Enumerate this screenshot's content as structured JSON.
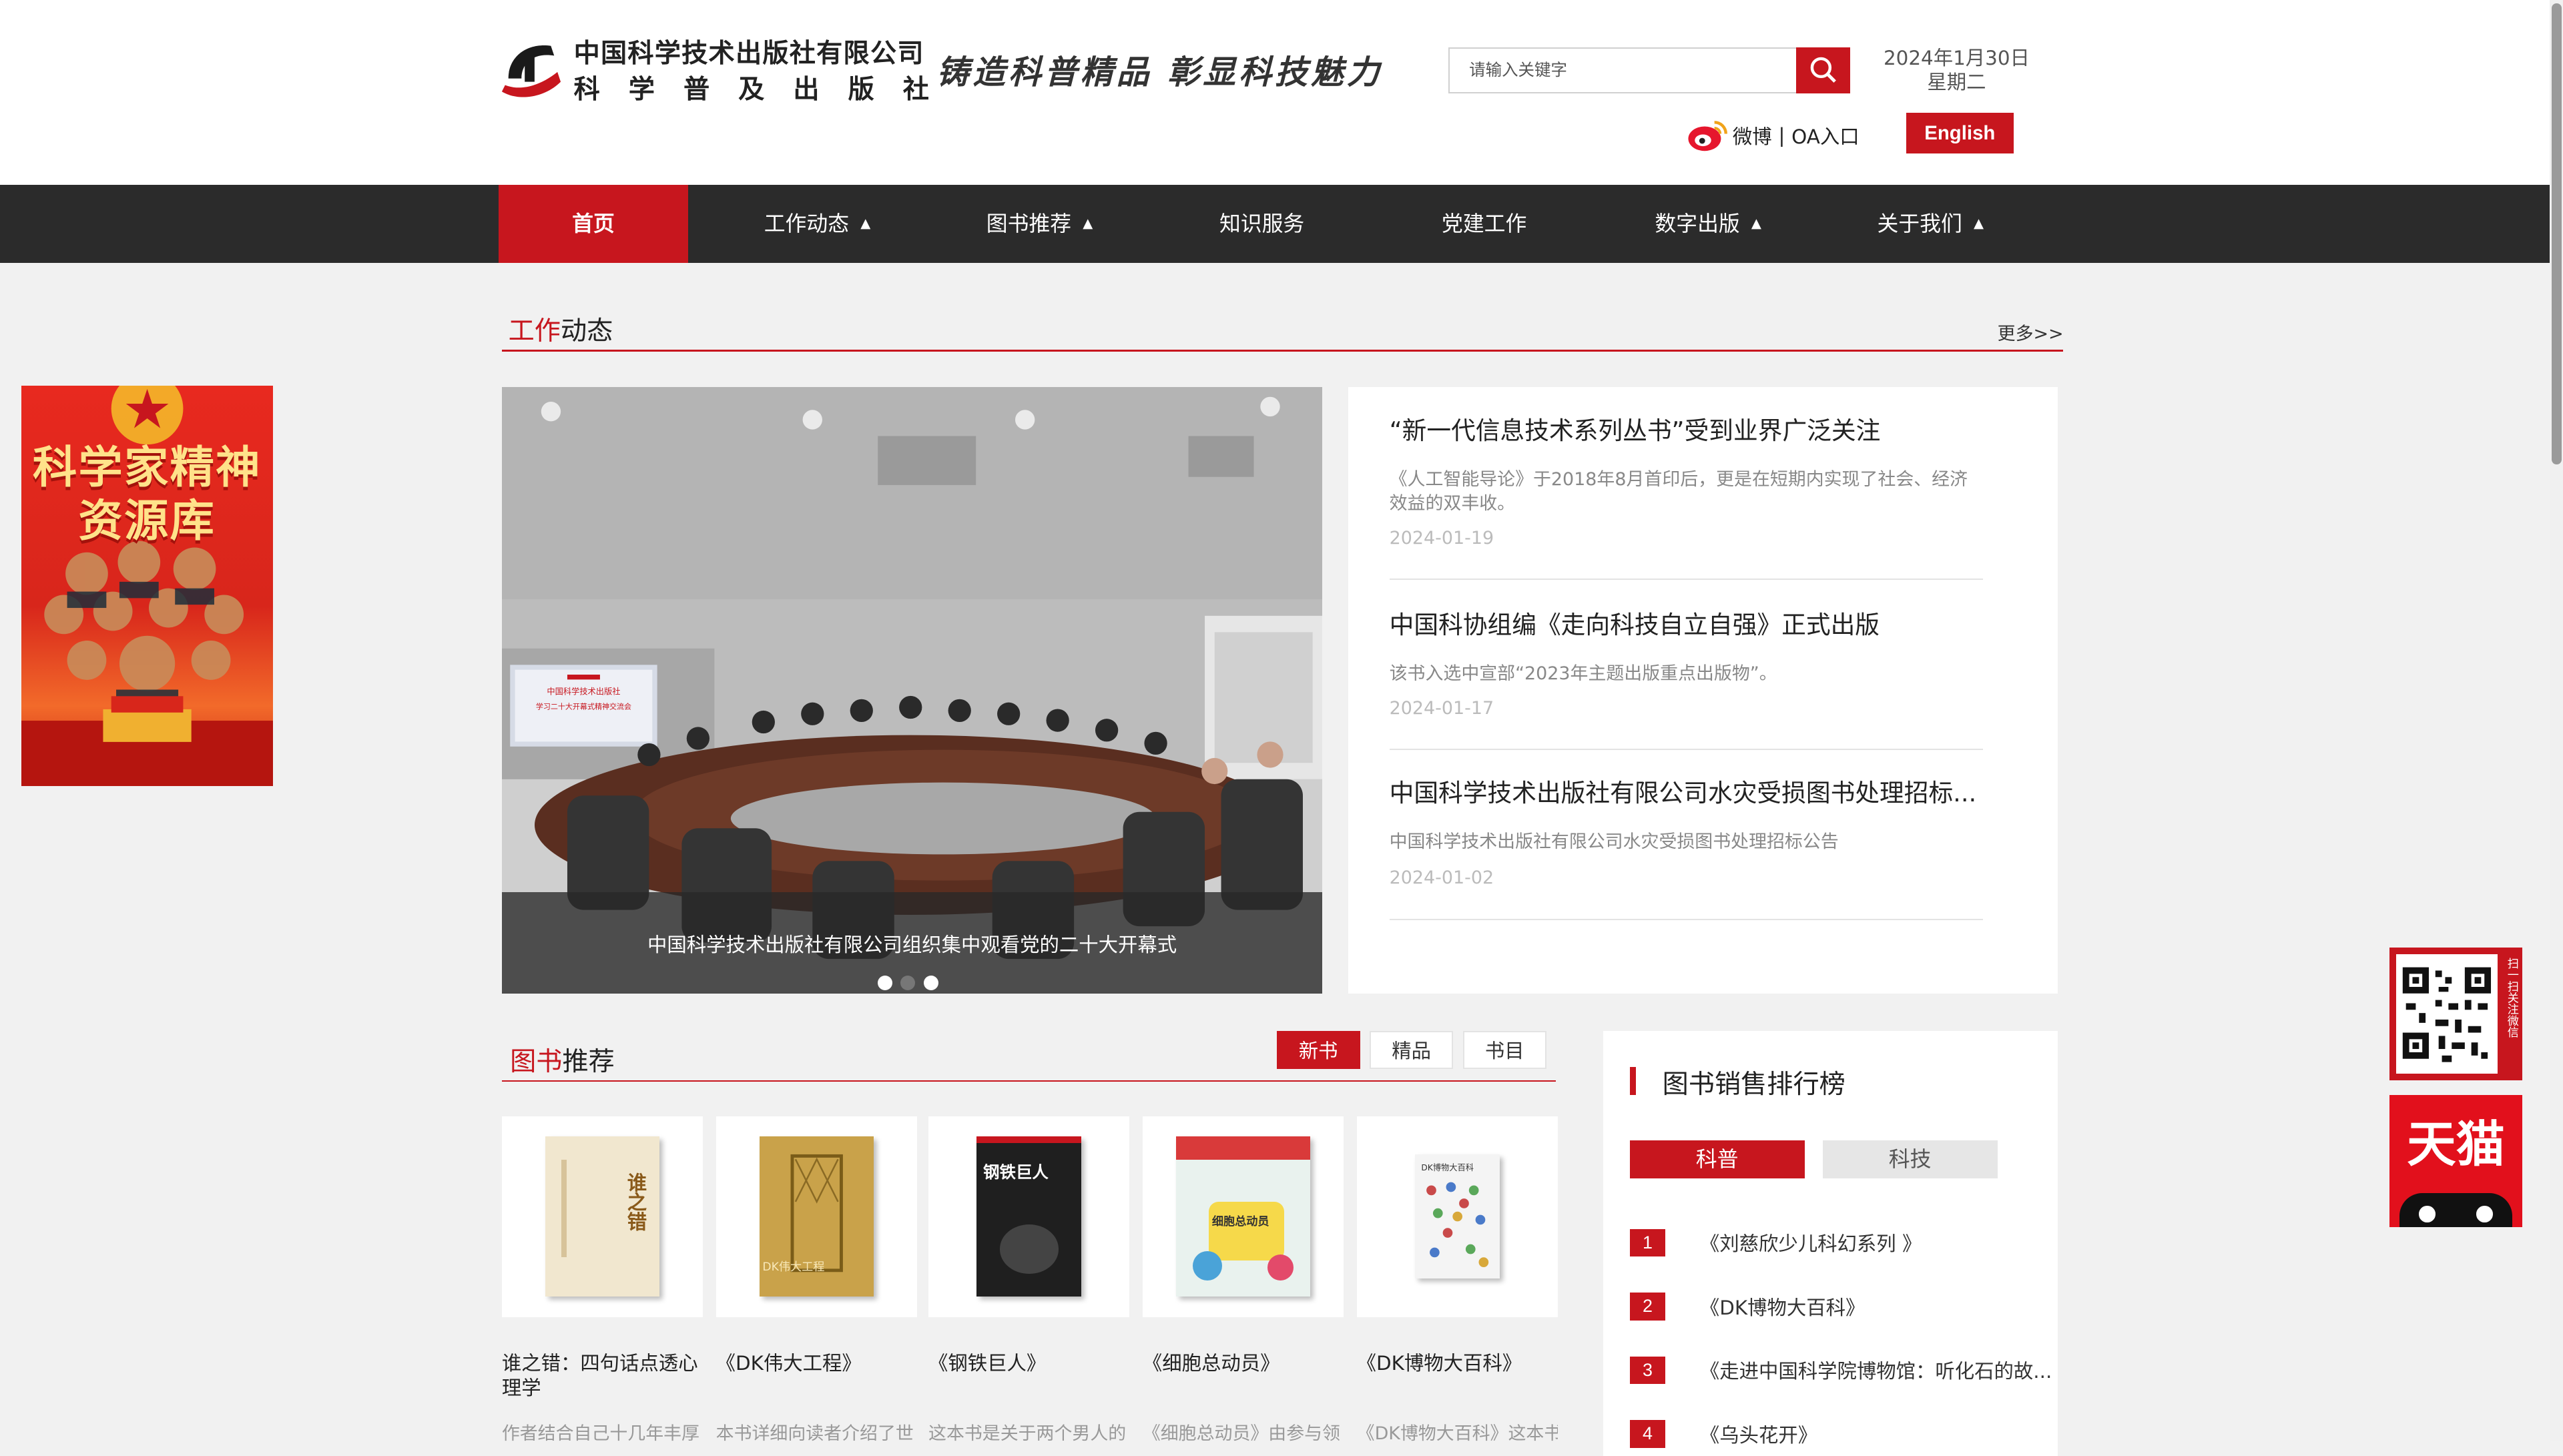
{
  "header": {
    "logo_line1": "中国科学技术出版社有限公司",
    "logo_line2": "科 学 普 及 出 版 社",
    "slogan": "铸造科普精品 彰显科技魅力",
    "search_placeholder": "请输入关键字",
    "date": "2024年1月30日",
    "weekday": "星期二",
    "weibo_label": "微博",
    "separator": "|",
    "oa_label": "OA入口",
    "english_label": "English"
  },
  "nav": {
    "items": [
      {
        "label": "首页",
        "active": true,
        "caret": ""
      },
      {
        "label": "工作动态",
        "caret": "▲"
      },
      {
        "label": "图书推荐",
        "caret": "▲"
      },
      {
        "label": "知识服务",
        "caret": ""
      },
      {
        "label": "党建工作",
        "caret": ""
      },
      {
        "label": "数字出版",
        "caret": "▲"
      },
      {
        "label": "关于我们",
        "caret": "▲"
      }
    ]
  },
  "left_banner": {
    "line1": "科学家精神",
    "line2": "资源库"
  },
  "work_news": {
    "title_red": "工作",
    "title_rest": "动态",
    "more": "更多>>",
    "slide_caption": "中国科学技术出版社有限公司组织集中观看党的二十大开幕式",
    "slide_screen_text1": "中国科学技术出版社",
    "slide_screen_text2": "学习二十大开幕式精神交流会",
    "slide_count": 3,
    "active_slide": 2,
    "items": [
      {
        "title": "“新一代信息技术系列丛书”受到业界广泛关注",
        "summary": "《人工智能导论》于2018年8月首印后，更是在短期内实现了社会、经济效益的双丰收。",
        "date": "2024-01-19"
      },
      {
        "title": "中国科协组编《走向科技自立自强》正式出版",
        "summary": "该书入选中宣部“2023年主题出版重点出版物”。",
        "date": "2024-01-17"
      },
      {
        "title": "中国科学技术出版社有限公司水灾受损图书处理招标...",
        "summary": "中国科学技术出版社有限公司水灾受损图书处理招标公告",
        "date": "2024-01-02"
      }
    ]
  },
  "book_rec": {
    "title_red": "图书",
    "title_rest": "推荐",
    "tabs": [
      "新书",
      "精品",
      "书目"
    ],
    "active_tab": 0,
    "books": [
      {
        "title": "谁之错：四句话点透心理学",
        "desc": "作者结合自己十几年丰厚",
        "cover_text": "谁之错",
        "cover_color": "#f1e7cf"
      },
      {
        "title": "《DK伟大工程》",
        "desc": "本书详细向读者介绍了世",
        "cover_text": "DK伟大工程",
        "cover_color": "#c9a24a"
      },
      {
        "title": "《钢铁巨人》",
        "desc": "这本书是关于两个男人的",
        "cover_text": "钢铁巨人",
        "cover_color": "#1f1f1f"
      },
      {
        "title": "《细胞总动员》",
        "desc": "《细胞总动员》由参与领",
        "cover_text": "细胞总动员",
        "cover_color": "#e9f2ee"
      },
      {
        "title": "《DK博物大百科》",
        "desc": "《DK博物大百科》这本书",
        "cover_text": "DK博物大百科",
        "cover_color": "#f4f4f4"
      }
    ]
  },
  "ranking": {
    "title": "图书销售排行榜",
    "tabs": [
      "科普",
      "科技"
    ],
    "active_tab": 0,
    "items": [
      {
        "num": "1",
        "title": "《刘慈欣少儿科幻系列 》"
      },
      {
        "num": "2",
        "title": "《DK博物大百科》"
      },
      {
        "num": "3",
        "title": "《走进中国科学院博物馆：听化石的故..."
      },
      {
        "num": "4",
        "title": "《乌头花开》"
      }
    ]
  },
  "float": {
    "qr_caption": "扫一扫关注微信",
    "tmall_label": "天猫"
  },
  "colors": {
    "brand_red": "#c7161e",
    "nav_bg": "#2b2b2b",
    "page_bg": "#f1f1f1"
  }
}
